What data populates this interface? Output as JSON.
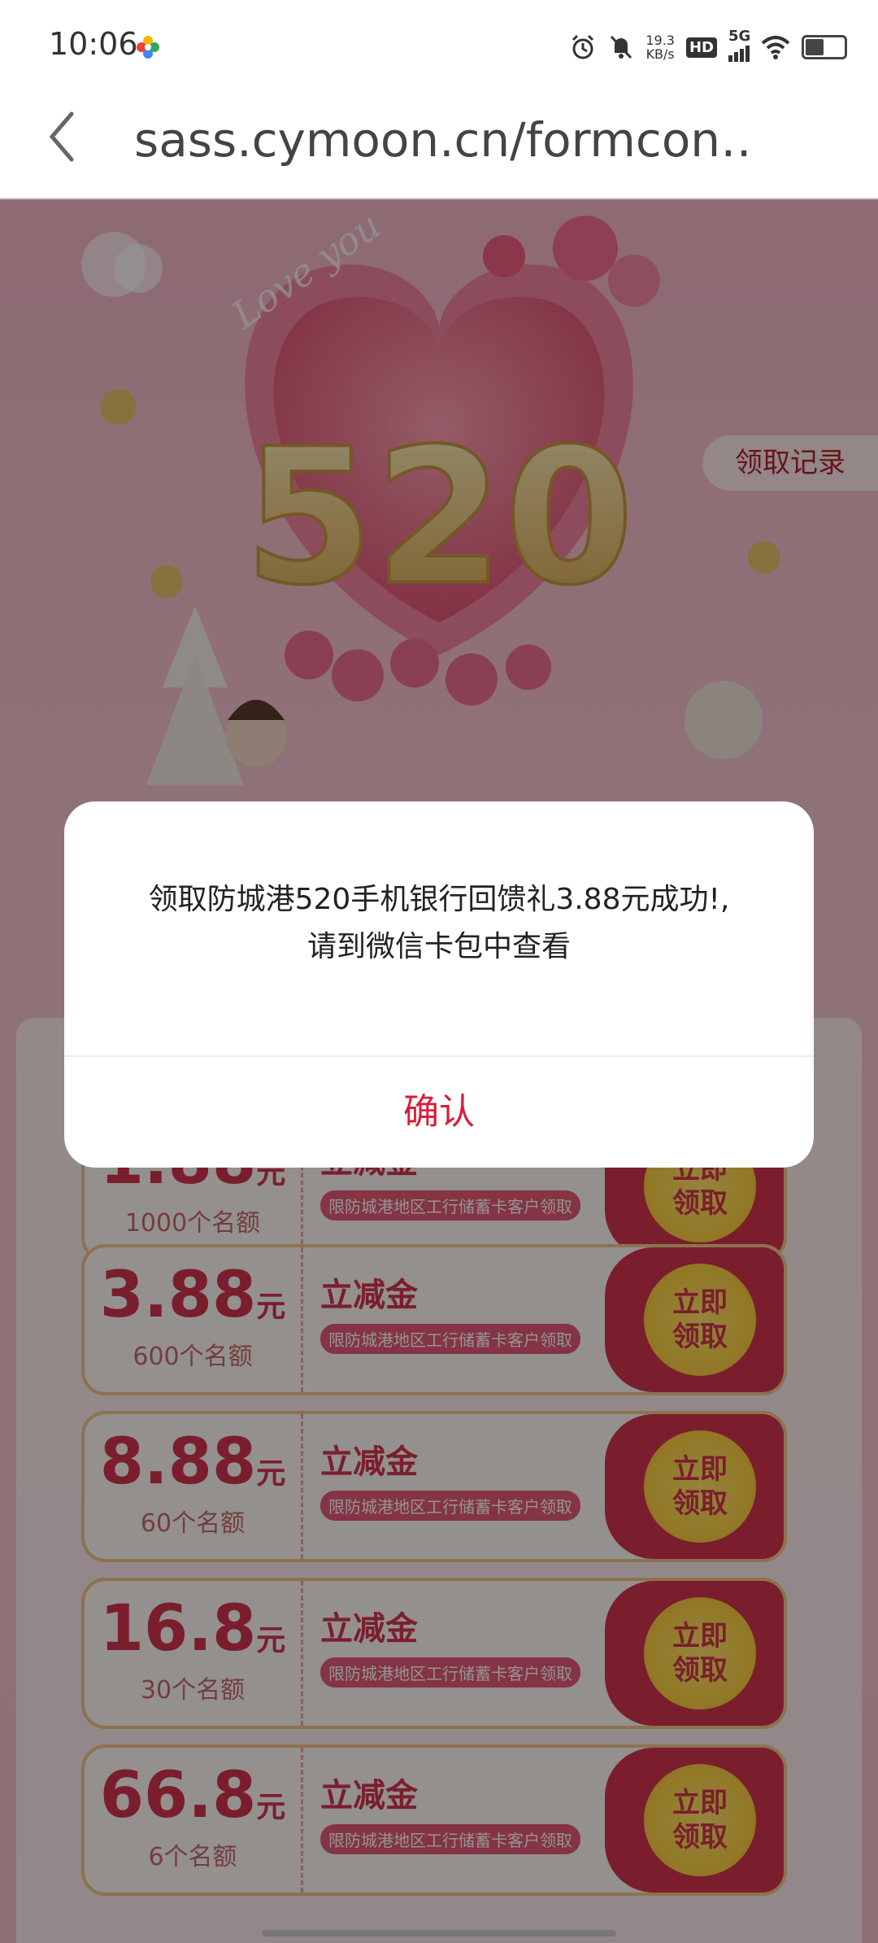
{
  "status_bar": {
    "time": "10:06",
    "net_speed_value": "19.3",
    "net_speed_unit": "KB/s",
    "hd_label": "HD",
    "network_label": "5G"
  },
  "browser": {
    "url": "sass.cymoon.cn/formcon…"
  },
  "hero": {
    "records_button": "领取记录",
    "decor_text": "Love you",
    "big_number": "520"
  },
  "coupons": [
    {
      "amount": "1.88",
      "unit": "元",
      "quota": "1000个名额",
      "title": "立减金",
      "condition": "限防城港地区工行储蓄卡客户领取",
      "btn_line1": "立即",
      "btn_line2": "领取"
    },
    {
      "amount": "3.88",
      "unit": "元",
      "quota": "600个名额",
      "title": "立减金",
      "condition": "限防城港地区工行储蓄卡客户领取",
      "btn_line1": "立即",
      "btn_line2": "领取"
    },
    {
      "amount": "8.88",
      "unit": "元",
      "quota": "60个名额",
      "title": "立减金",
      "condition": "限防城港地区工行储蓄卡客户领取",
      "btn_line1": "立即",
      "btn_line2": "领取"
    },
    {
      "amount": "16.8",
      "unit": "元",
      "quota": "30个名额",
      "title": "立减金",
      "condition": "限防城港地区工行储蓄卡客户领取",
      "btn_line1": "立即",
      "btn_line2": "领取"
    },
    {
      "amount": "66.8",
      "unit": "元",
      "quota": "6个名额",
      "title": "立减金",
      "condition": "限防城港地区工行储蓄卡客户领取",
      "btn_line1": "立即",
      "btn_line2": "领取"
    }
  ],
  "dialog": {
    "message_line1": "领取防城港520手机银行回馈礼3.88元成功!,",
    "message_line2": "请到微信卡包中查看",
    "confirm_label": "确认"
  },
  "colors": {
    "brand_red": "#d2344f",
    "confirm_red": "#d81e3a",
    "button_yellow": "#f8c42d"
  }
}
